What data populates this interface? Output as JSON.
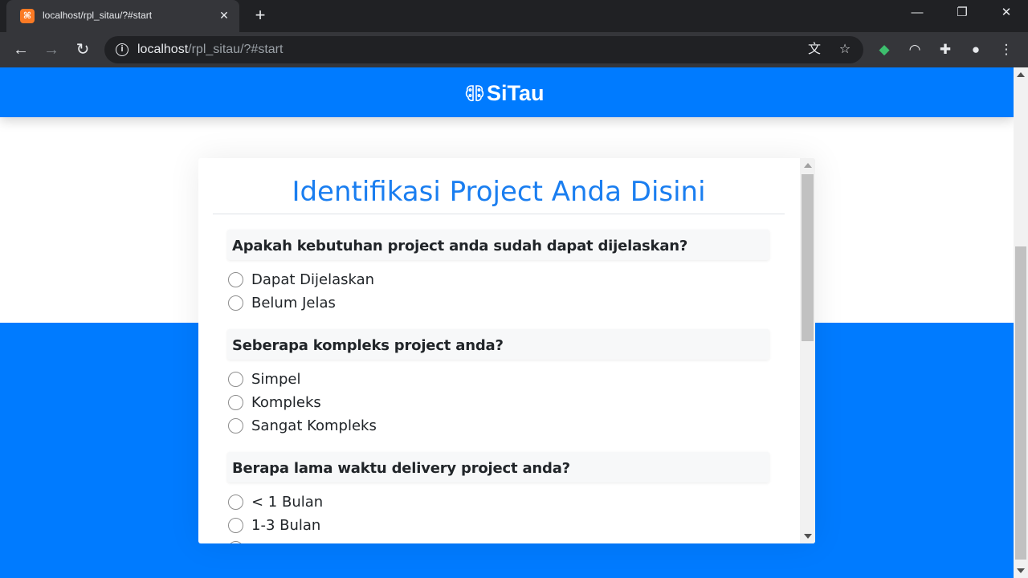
{
  "browser": {
    "tab_title": "localhost/rpl_sitau/?#start",
    "tab_favicon": "xampp-icon",
    "url_host": "localhost",
    "url_path": "/rpl_sitau/?#start",
    "icons": [
      "back-icon",
      "forward-icon",
      "reload-icon",
      "info-icon",
      "translate-icon",
      "bookmark-star-icon",
      "extension-icon",
      "profile-icon",
      "menu-icon"
    ]
  },
  "navbar": {
    "brand": "SiTau",
    "color": "#007bff"
  },
  "form": {
    "title": "Identifikasi Project Anda Disini",
    "questions": [
      {
        "question": "Apakah kebutuhan project anda sudah dapat dijelaskan?",
        "options": [
          "Dapat Dijelaskan",
          "Belum Jelas"
        ]
      },
      {
        "question": "Seberapa kompleks project anda?",
        "options": [
          "Simpel",
          "Kompleks",
          "Sangat Kompleks"
        ]
      },
      {
        "question": "Berapa lama waktu delivery project anda?",
        "options": [
          "< 1 Bulan",
          "1-3 Bulan"
        ]
      }
    ]
  },
  "colors": {
    "accent": "#007bff",
    "title": "#1a7ef0"
  }
}
